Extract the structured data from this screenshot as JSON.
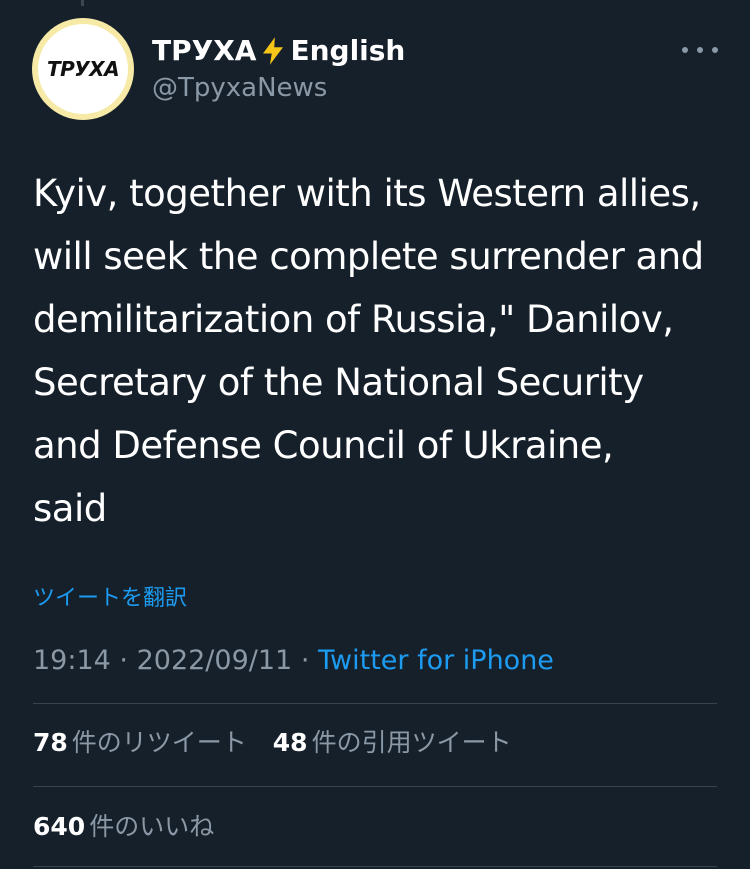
{
  "user": {
    "avatar_text": "ТРУХА",
    "display_name_prefix": "ТРУХА",
    "display_name_suffix": "English",
    "handle": "@TpyxaNews"
  },
  "icons": {
    "verified_bolt": "lightning-bolt-icon",
    "bolt_color": "#f5c518",
    "more": "more-horizontal-icon"
  },
  "tweet": {
    "text": "Kyiv, together with its Western allies,\nwill seek the complete surrender and\ndemilitarization of Russia,\" Danilov,\nSecretary of the National Security\nand Defense Council of Ukraine,\nsaid",
    "translate_label": "ツイートを翻訳",
    "time": "19:14",
    "separator": "·",
    "date": "2022/09/11",
    "source": "Twitter for iPhone"
  },
  "stats": {
    "retweets_count": "78",
    "retweets_label": "件のリツイート",
    "quotes_count": "48",
    "quotes_label": "件の引用ツイート",
    "likes_count": "640",
    "likes_label": "件のいいね"
  },
  "colors": {
    "background": "#15202b",
    "text_primary": "#ffffff",
    "text_secondary": "#8b98a5",
    "accent": "#1d9bf0",
    "divider": "#38444d"
  }
}
